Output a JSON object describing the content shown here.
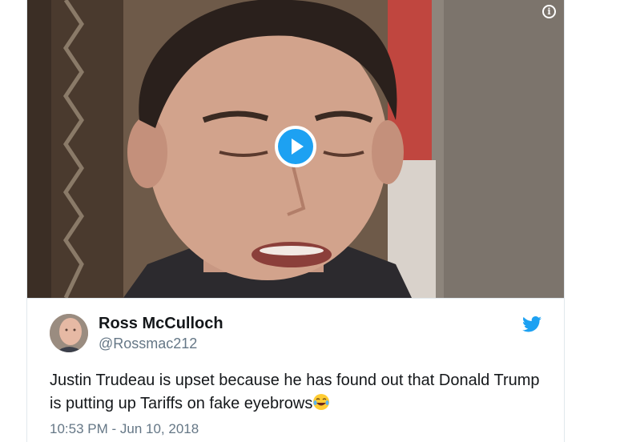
{
  "media": {
    "info_icon": "info-icon",
    "play_icon": "play-icon",
    "accent": "#1da1f2"
  },
  "tweet": {
    "author_name": "Ross McCulloch",
    "author_handle": "@Rossmac212",
    "text": "Justin Trudeau is upset because he has found out that Donald Trump is putting up Tariffs on fake eyebrows",
    "emoji": "😂",
    "timestamp": "10:53 PM - Jun 10, 2018",
    "platform_icon": "twitter-bird-icon"
  }
}
